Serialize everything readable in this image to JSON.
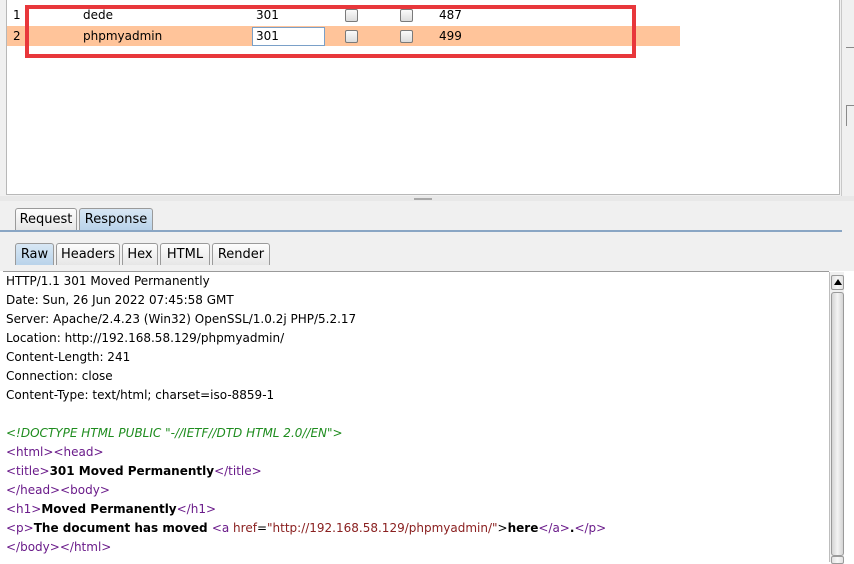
{
  "results": {
    "rows": [
      {
        "num": "1",
        "payload": "dede",
        "status": "301",
        "length": "487",
        "selected": false
      },
      {
        "num": "2",
        "payload": "phpmyadmin",
        "status": "301",
        "length": "499",
        "selected": true
      }
    ]
  },
  "message_tabs": [
    "Request",
    "Response"
  ],
  "view_tabs": [
    "Raw",
    "Headers",
    "Hex",
    "HTML",
    "Render"
  ],
  "response": {
    "headers": [
      "HTTP/1.1 301 Moved Permanently",
      "Date: Sun, 26 Jun 2022 07:45:58 GMT",
      "Server: Apache/2.4.23 (Win32) OpenSSL/1.0.2j PHP/5.2.17",
      "Location: http://192.168.58.129/phpmyadmin/",
      "Content-Length: 241",
      "Connection: close",
      "Content-Type: text/html; charset=iso-8859-1"
    ],
    "doctype": "<!DOCTYPE HTML PUBLIC \"-//IETF//DTD HTML 2.0//EN\">",
    "html_open": "<html>",
    "head_open": "<head>",
    "title_open": "<title>",
    "title_text": "301 Moved Permanently",
    "title_close": "</title>",
    "head_close": "</head>",
    "body_open": "<body>",
    "h1_open": "<h1>",
    "h1_text": "Moved Permanently",
    "h1_close": "</h1>",
    "p_open": "<p>",
    "p_text": "The document has moved ",
    "a_open": "<a ",
    "a_attr": "href",
    "a_eq": "=",
    "a_value": "\"http://192.168.58.129/phpmyadmin/\"",
    "a_gt": ">",
    "a_text": "here",
    "a_close": "</a>",
    "period": ".",
    "p_close": "</p>",
    "body_close": "</body>",
    "html_close": "</html>"
  },
  "colors": {
    "selected_row": "#ffc49a",
    "highlight": "#e8373b",
    "doctype": "#1e8c1e",
    "tag": "#6a1b8a",
    "attr": "#8a2020"
  }
}
